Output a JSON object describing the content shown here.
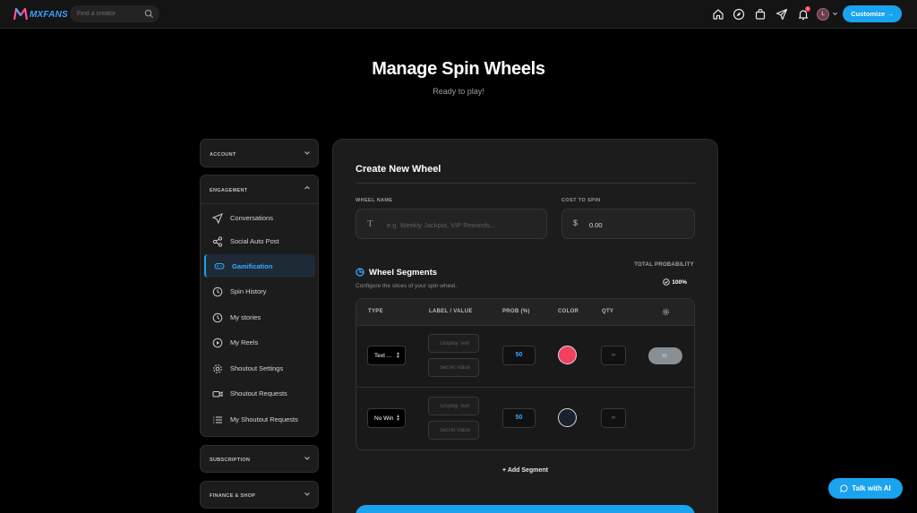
{
  "topbar": {
    "logo_text": "MXFANS",
    "search_placeholder": "Find a creator",
    "notification_count": "5",
    "avatar_initial": "L",
    "customize_label": "Customize →",
    "icons": [
      "home-icon",
      "compass-icon",
      "shopping-bag-icon",
      "send-icon",
      "bell-icon"
    ]
  },
  "header": {
    "title": "Manage Spin Wheels",
    "subtitle": "Ready to play!"
  },
  "sidebar": {
    "account_label": "ACCOUNT",
    "engagement_label": "ENGAGEMENT",
    "subscription_label": "SUBSCRIPTION",
    "finance_label": "FINANCE & SHOP",
    "items": [
      {
        "label": "Conversations",
        "icon": "send-icon"
      },
      {
        "label": "Social Auto Post",
        "icon": "share-icon"
      },
      {
        "label": "Gamification",
        "icon": "gamepad-icon",
        "active": true
      },
      {
        "label": "Spin History",
        "icon": "clock-icon"
      },
      {
        "label": "My stories",
        "icon": "clock-icon"
      },
      {
        "label": "My Reels",
        "icon": "play-circle-icon"
      },
      {
        "label": "Shoutout Settings",
        "icon": "gear-icon"
      },
      {
        "label": "Shoutout Requests",
        "icon": "video-icon"
      },
      {
        "label": "My Shoutout Requests",
        "icon": "list-icon"
      }
    ]
  },
  "form": {
    "title": "Create New Wheel",
    "wheel_name_label": "WHEEL NAME",
    "wheel_name_placeholder": "e.g. Weekly Jackpot, VIP Rewards...",
    "cost_label": "COST TO SPIN",
    "cost_currency": "$",
    "cost_value": "0.00"
  },
  "segments": {
    "title": "Wheel Segments",
    "subtitle": "Configure the slices of your spin wheel.",
    "total_prob_label": "TOTAL PROBABILITY",
    "total_prob_value": "100%",
    "columns": {
      "type": "TYPE",
      "label": "LABEL / VALUE",
      "prob": "PROB (%)",
      "color": "COLOR",
      "qty": "QTY"
    },
    "rows": [
      {
        "type": "Text ...",
        "display_placeholder": "Display Text",
        "secret_placeholder": "Secret Value",
        "prob": "50",
        "color": "#f2405e",
        "qty": "∞"
      },
      {
        "type": "No Win",
        "display_placeholder": "Display Text",
        "secret_placeholder": "Secret Value",
        "prob": "50",
        "color": "#1c1f2e",
        "qty": "∞"
      }
    ],
    "add_label": "Add Segment"
  },
  "chat": {
    "label": "Talk with AI"
  },
  "colors": {
    "accent": "#1aa3ee",
    "background": "#000000",
    "card": "#1c1c1c"
  }
}
